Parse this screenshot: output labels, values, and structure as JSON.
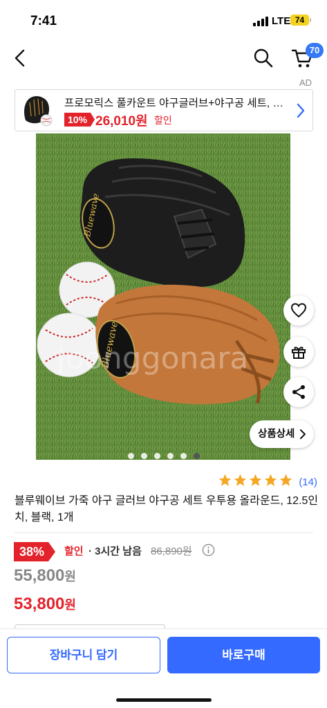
{
  "status": {
    "time": "7:41",
    "network": "LTE",
    "battery": "74"
  },
  "header": {
    "back_icon": "chevron-left-icon",
    "search_icon": "search-icon",
    "cart_icon": "cart-icon",
    "cart_count": "70"
  },
  "ad": {
    "label": "AD",
    "title": "프로모릭스 풀카운트 야구글러브+야구공 세트, 블랙",
    "discount": "10%",
    "price": "26,010원",
    "sale_label": "할인"
  },
  "gallery": {
    "image_count": 7,
    "active_index": 6,
    "watermark": "Joonggonara",
    "glove_brand": "Bluewave",
    "detail_button": "상품상세"
  },
  "rating": {
    "stars": 5,
    "count": "(14)"
  },
  "product": {
    "title": "블루웨이브 가죽 야구 글러브 야구공 세트 우투용 올라운드, 12.5인치, 블랙, 1개"
  },
  "pricing": {
    "discount_rate": "38%",
    "sale_label": "할인",
    "time_left": "· 3시간 남음",
    "original_price": "86,890원",
    "price_1_num": "55,800",
    "price_1_unit": "원",
    "price_2_num": "53,800",
    "price_2_unit": "원"
  },
  "actions": {
    "add_to_cart": "장바구니 담기",
    "buy_now": "바로구매"
  },
  "colors": {
    "accent_blue": "#346aff",
    "sale_red": "#e3232c",
    "star_orange": "#f5a623"
  }
}
